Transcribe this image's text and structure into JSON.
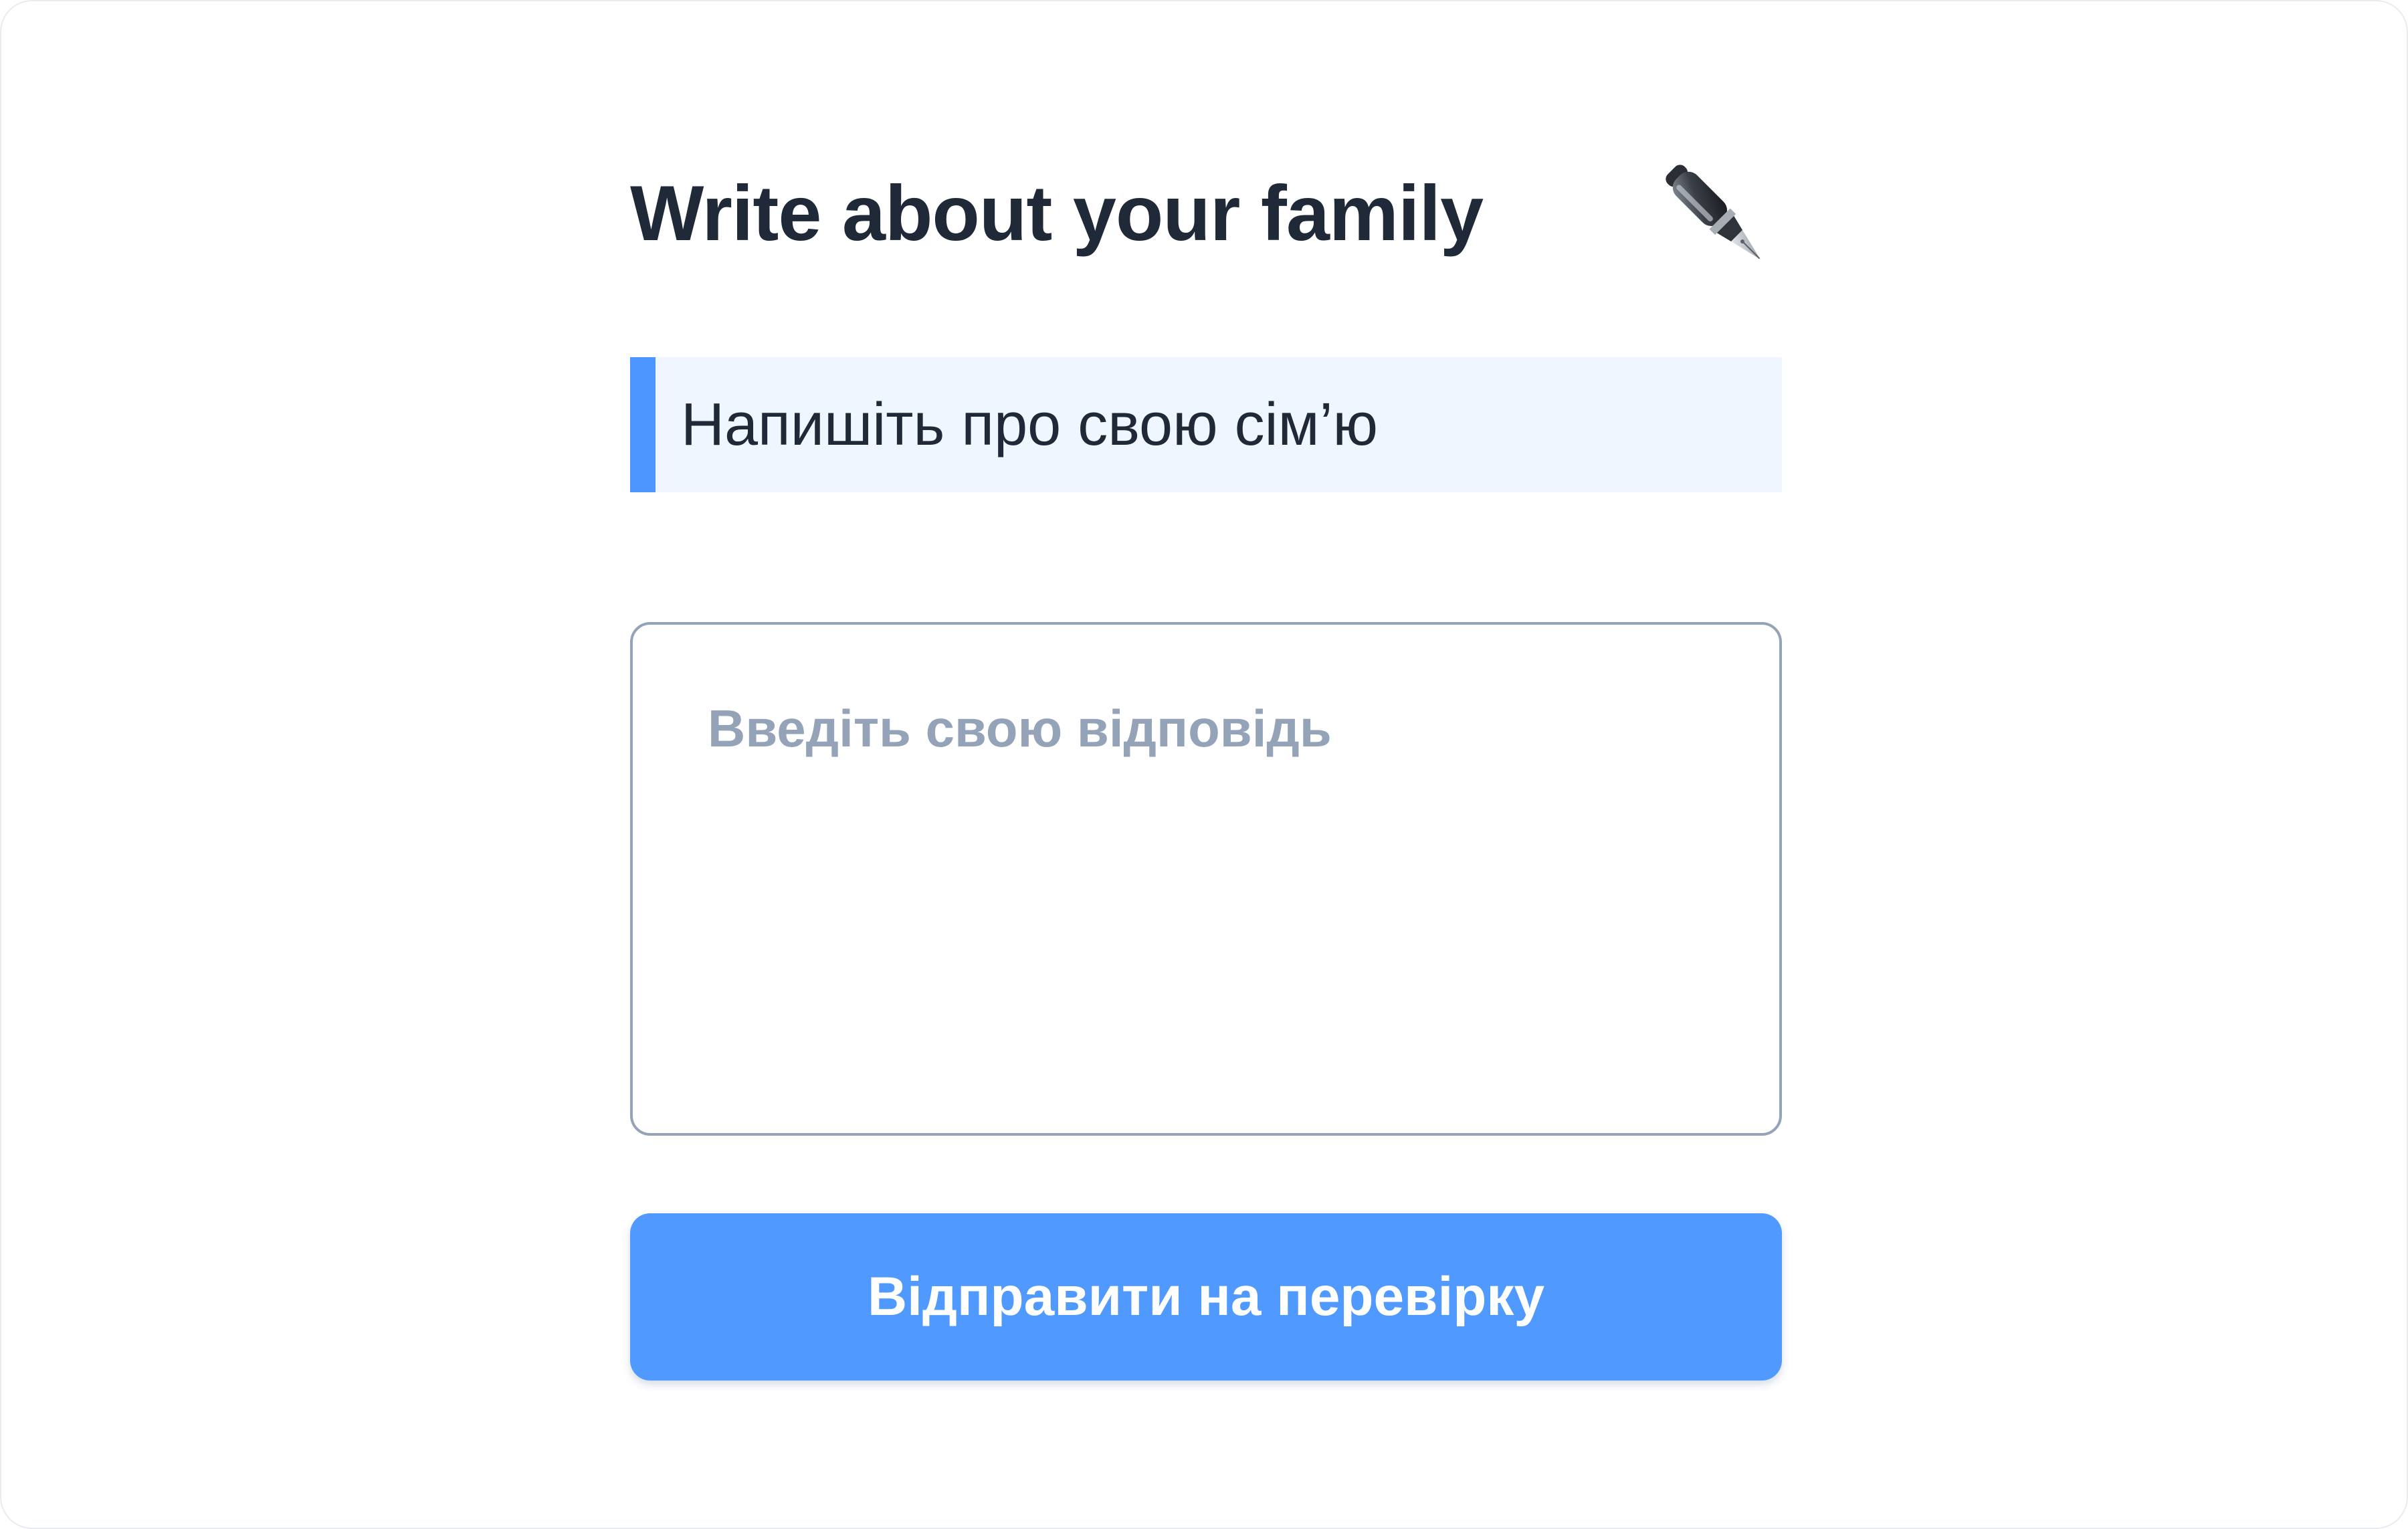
{
  "header": {
    "title": "Write about your family",
    "icon": "fountain-pen-icon"
  },
  "prompt": {
    "text": "Напишіть про свою сім’ю"
  },
  "answer": {
    "placeholder": "Введіть свою відповідь",
    "value": ""
  },
  "submit": {
    "label": "Відправити на перевірку"
  },
  "colors": {
    "accent": "#4f99ff",
    "prompt_background": "#eff6ff",
    "title_text": "#1f2937",
    "placeholder_text": "#94a3b8",
    "input_border": "#94a3b8"
  }
}
